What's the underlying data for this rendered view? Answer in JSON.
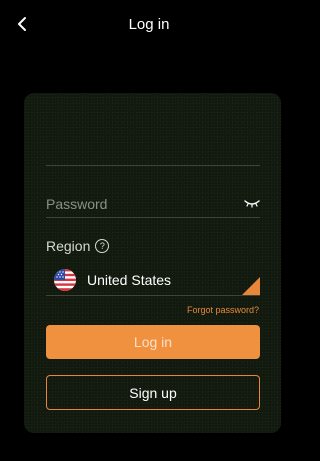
{
  "header": {
    "title": "Log in",
    "back_icon": "chevron-left-icon"
  },
  "form": {
    "password_placeholder": "Password",
    "password_value": "",
    "visibility_icon": "eye-closed-icon",
    "region_label": "Region",
    "region_help_icon": "question-circle-icon",
    "region_help_glyph": "?",
    "region_value": "United States",
    "region_flag_icon": "us-flag-icon",
    "forgot_label": "Forgot password?",
    "login_label": "Log in",
    "signup_label": "Sign up"
  },
  "colors": {
    "background": "#000000",
    "accent": "#f0913f",
    "card": "#121a10"
  }
}
